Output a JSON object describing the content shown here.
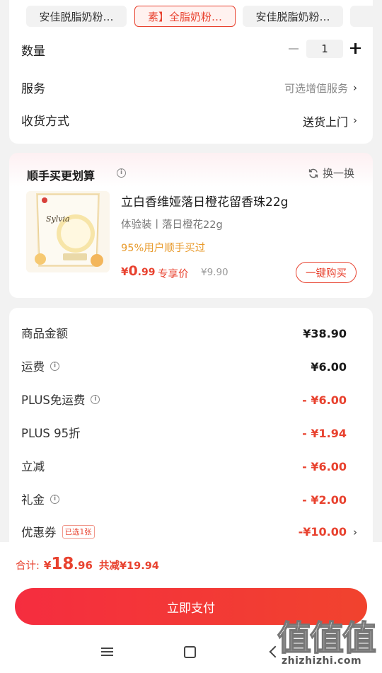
{
  "spec": {
    "chips": [
      "安佳脱脂奶粉…",
      "素】全脂奶粉…",
      "安佳脱脂奶粉…"
    ],
    "quantity_label": "数量",
    "quantity_value": "1",
    "service_label": "服务",
    "service_value": "可选增值服务",
    "delivery_label": "收货方式",
    "delivery_value": "送货上门",
    "chevron": "›"
  },
  "addon": {
    "title": "顺手买更划算",
    "swap_label": "换一换",
    "product_name": "立白香维娅落日橙花留香珠22g",
    "product_spec": "体验装丨落日橙花22g",
    "bought_hint": "95%用户顺手买过",
    "price_symbol": "¥",
    "price_int": "0",
    "price_dec": ".99",
    "price_tag": "专享价",
    "original_price": "¥9.90",
    "buy_button": "一键购买",
    "image_brand_text": "Sylvia"
  },
  "fees": [
    {
      "label": "商品金额",
      "value": "¥38.90",
      "info": false,
      "red": false
    },
    {
      "label": "运费",
      "value": "¥6.00",
      "info": true,
      "red": false
    },
    {
      "label": "PLUS免运费",
      "value": "- ¥6.00",
      "info": true,
      "red": true
    },
    {
      "label": "PLUS 95折",
      "value": "- ¥1.94",
      "info": false,
      "red": true
    },
    {
      "label": "立减",
      "value": "- ¥6.00",
      "info": false,
      "red": true
    },
    {
      "label": "礼金",
      "value": "- ¥2.00",
      "info": true,
      "red": true
    },
    {
      "label": "优惠券",
      "value": "-¥10.00",
      "info": false,
      "red": true,
      "badge": "已选1张",
      "chevron": "›"
    }
  ],
  "bottom": {
    "total_label": "合计:",
    "total_symbol": "¥",
    "total_int": "18",
    "total_dec": ".96",
    "discount_text": "共减¥19.94",
    "pay_button": "立即支付"
  },
  "watermark": {
    "glyphs": "值值值",
    "url": "zhizhizhi.com"
  },
  "colors": {
    "accent": "#e8422f",
    "pay_button": "#f52d3f",
    "bought_hint": "#e89a2b",
    "page_bg": "#f2f2f2"
  }
}
